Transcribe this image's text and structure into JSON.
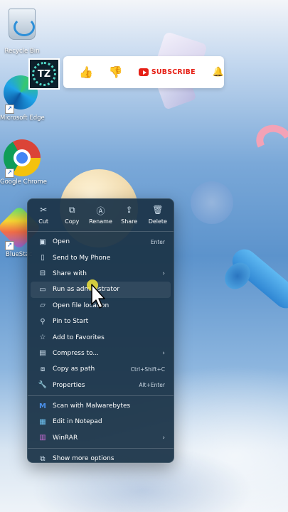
{
  "desktop": {
    "icons": [
      {
        "label": "Recycle Bin",
        "icon": "recycle-bin-icon"
      },
      {
        "label": "Microsoft Edge",
        "icon": "edge-icon"
      },
      {
        "label": "Google Chrome",
        "icon": "chrome-icon"
      },
      {
        "label": "BlueStac",
        "icon": "bluestacks-icon"
      }
    ]
  },
  "banner": {
    "avatar_text": "TZ",
    "subscribe_label": "SUBSCRIBE",
    "colors": {
      "subscribe": "#e62117"
    }
  },
  "context_menu": {
    "toolbar": [
      {
        "label": "Cut",
        "icon": "scissors-icon"
      },
      {
        "label": "Copy",
        "icon": "copy-icon"
      },
      {
        "label": "Rename",
        "icon": "rename-icon"
      },
      {
        "label": "Share",
        "icon": "share-icon"
      },
      {
        "label": "Delete",
        "icon": "trash-icon"
      }
    ],
    "items": [
      {
        "label": "Open",
        "shortcut": "Enter"
      },
      {
        "label": "Send to My Phone",
        "shortcut": ""
      },
      {
        "label": "Share with",
        "shortcut": ""
      },
      {
        "label": "Run as administrator",
        "shortcut": ""
      },
      {
        "label": "Open file location",
        "shortcut": ""
      },
      {
        "label": "Pin to Start",
        "shortcut": ""
      },
      {
        "label": "Add to Favorites",
        "shortcut": ""
      },
      {
        "label": "Compress to...",
        "shortcut": ""
      },
      {
        "label": "Copy as path",
        "shortcut": "Ctrl+Shift+C"
      },
      {
        "label": "Properties",
        "shortcut": "Alt+Enter"
      },
      {
        "label": "Scan with Malwarebytes",
        "shortcut": ""
      },
      {
        "label": "Edit in Notepad",
        "shortcut": ""
      },
      {
        "label": "WinRAR",
        "shortcut": ""
      },
      {
        "label": "Show more options",
        "shortcut": ""
      }
    ],
    "highlighted_item": "Run as administrator",
    "colors": {
      "background": "#1c3448"
    }
  }
}
